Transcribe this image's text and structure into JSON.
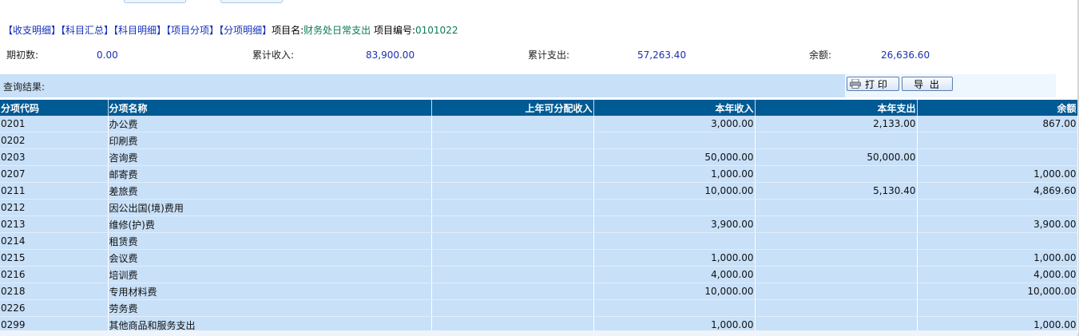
{
  "nav": {
    "links": [
      "【收支明细】",
      "【科目汇总】",
      "【科目明细】",
      "【项目分项】",
      "【分项明细】"
    ],
    "project_name_label": "项目名:",
    "project_name": "财务处日常支出",
    "project_code_label": "项目编号:",
    "project_code": "0101022"
  },
  "summary": {
    "opening_label": "期初数:",
    "opening_value": "0.00",
    "income_label": "累计收入:",
    "income_value": "83,900.00",
    "expense_label": "累计支出:",
    "expense_value": "57,263.40",
    "balance_label": "余额:",
    "balance_value": "26,636.60"
  },
  "query": {
    "label": "查询结果:",
    "print_label": "打 印",
    "export_label": "导 出"
  },
  "table": {
    "headers": [
      "分项代码",
      "分项名称",
      "上年可分配收入",
      "本年收入",
      "本年支出",
      "余额"
    ],
    "rows": [
      [
        "0201",
        "办公费",
        "",
        "3,000.00",
        "2,133.00",
        "867.00"
      ],
      [
        "0202",
        "印刷费",
        "",
        "",
        "",
        ""
      ],
      [
        "0203",
        "咨询费",
        "",
        "50,000.00",
        "50,000.00",
        ""
      ],
      [
        "0207",
        "邮寄费",
        "",
        "1,000.00",
        "",
        "1,000.00"
      ],
      [
        "0211",
        "差旅费",
        "",
        "10,000.00",
        "5,130.40",
        "4,869.60"
      ],
      [
        "0212",
        "因公出国(境)费用",
        "",
        "",
        "",
        ""
      ],
      [
        "0213",
        "维修(护)费",
        "",
        "3,900.00",
        "",
        "3,900.00"
      ],
      [
        "0214",
        "租赁费",
        "",
        "",
        "",
        ""
      ],
      [
        "0215",
        "会议费",
        "",
        "1,000.00",
        "",
        "1,000.00"
      ],
      [
        "0216",
        "培训费",
        "",
        "4,000.00",
        "",
        "4,000.00"
      ],
      [
        "0218",
        "专用材料费",
        "",
        "10,000.00",
        "",
        "10,000.00"
      ],
      [
        "0226",
        "劳务费",
        "",
        "",
        "",
        ""
      ],
      [
        "0299",
        "其他商品和服务支出",
        "",
        "1,000.00",
        "",
        "1,000.00"
      ]
    ]
  }
}
